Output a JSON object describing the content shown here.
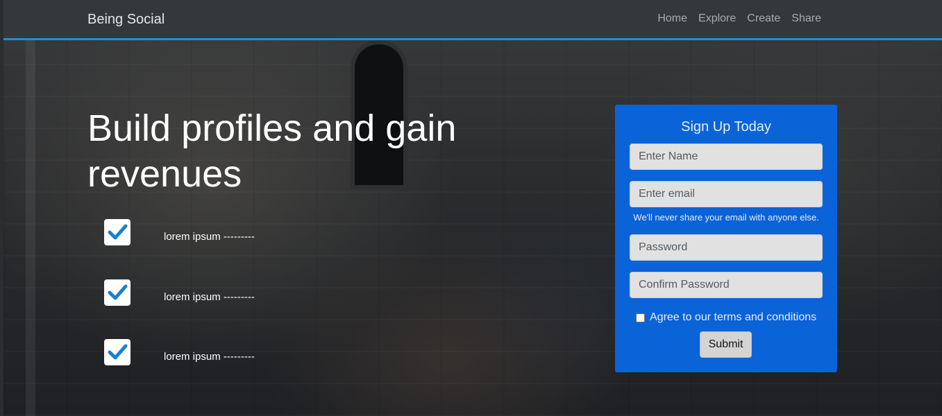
{
  "navbar": {
    "brand": "Being Social",
    "links": [
      "Home",
      "Explore",
      "Create",
      "Share"
    ]
  },
  "hero": {
    "headline": "Build profiles and gain revenues",
    "features": [
      "lorem ipsum ---------",
      "lorem ipsum ---------",
      "lorem ipsum ---------"
    ]
  },
  "signup": {
    "title": "Sign Up Today",
    "name_placeholder": "Enter Name",
    "email_placeholder": "Enter email",
    "email_help": "We'll never share your email with anyone else.",
    "password_placeholder": "Password",
    "confirm_placeholder": "Confirm Password",
    "agree_label": "Agree to our terms and conditions",
    "submit_label": "Submit"
  },
  "colors": {
    "accent": "#1d8fd8",
    "card": "#0b63d8",
    "check": "#1a7fd0"
  }
}
